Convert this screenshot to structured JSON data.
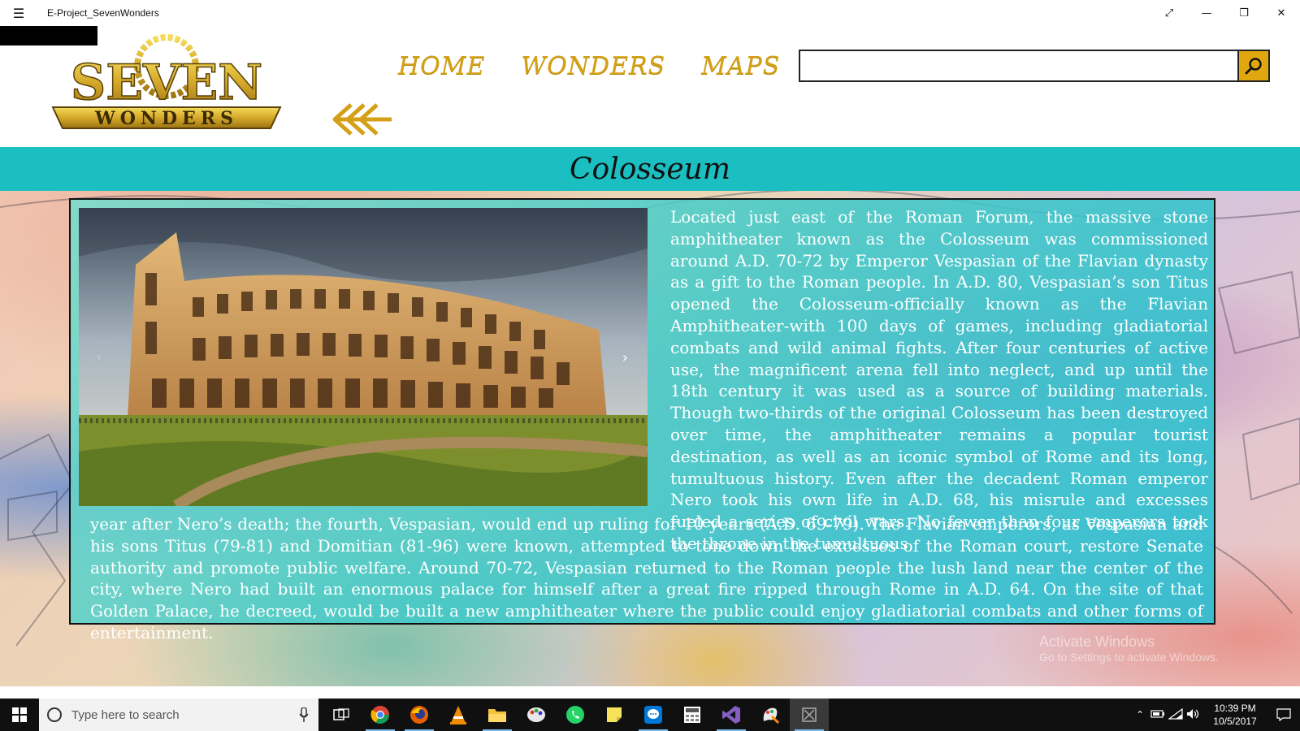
{
  "window": {
    "title": "E-Project_SevenWonders",
    "menu_icon": "hamburger-icon",
    "controls": [
      "fullscreen-icon",
      "minimize-icon",
      "restore-icon",
      "close-icon"
    ]
  },
  "header": {
    "logo_line1": "SEVEN",
    "logo_line2": "WONDERS",
    "nav": [
      "HOME",
      "WONDERS",
      "MAPS"
    ],
    "search": {
      "value": "",
      "placeholder": "",
      "icon": "search-icon"
    },
    "back_icon": "double-arrow-back-icon"
  },
  "banner": {
    "title": "Colosseum"
  },
  "content": {
    "paragraph_right": "Located just east of the Roman Forum, the massive stone amphitheater known as the Colosseum was commissioned around A.D. 70-72 by Emperor Vespasian of the Flavian dynasty as a gift to the Roman people. In A.D. 80, Vespasian’s son Titus opened the Colosseum-officially known as the Flavian Amphitheater-with 100 days of games, including gladiatorial combats and wild animal fights. After four centuries of active use, the magnificent arena fell into neglect, and up until the 18th century it was used as a source of building materials. Though two-thirds of the original Colosseum has been destroyed over time, the amphitheater remains a popular tourist destination, as well as an iconic symbol of Rome and its long, tumultuous history. Even after the decadent Roman emperor Nero took his own life in A.D. 68, his misrule and excesses fueled a series of civil wars. No fewer than four emperors took the throne in the tumultuous",
    "paragraph_bottom": "year after Nero’s death; the fourth, Vespasian, would end up ruling for 10 years (A.D. 69-79). The Flavian emperors, as Vespasian and his sons Titus (79-81) and Domitian (81-96) were known, attempted to tone down the excesses of the Roman court, restore Senate authority and promote public welfare. Around 70-72, Vespasian returned to the Roman people the lush land near the center of the city, where Nero had built an enormous palace for himself after a great fire ripped through Rome in A.D. 64. On the site of that Golden Palace, he decreed, would be built a new amphitheater where the public could enjoy gladiatorial combats and other forms of entertainment.",
    "image_alt": "Colosseum photo",
    "next_symbol": "›",
    "prev_symbol": "‹"
  },
  "watermark": {
    "line1": "Activate Windows",
    "line2": "Go to Settings to activate Windows."
  },
  "taskbar": {
    "search_placeholder": "Type here to search",
    "apps": [
      "task-view-icon",
      "chrome-icon",
      "firefox-icon",
      "vlc-icon",
      "file-explorer-icon",
      "paint-icon",
      "whatsapp-icon",
      "sticky-notes-icon",
      "messaging-icon",
      "calculator-icon",
      "visual-studio-icon",
      "paint3d-icon",
      "app-icon"
    ],
    "time": "10:39 PM",
    "date": "10/5/2017",
    "colors": {
      "accent": "#76b9ed",
      "taskbar_bg": "#101010"
    }
  },
  "colors": {
    "nav_gold": "#d4a017",
    "banner_teal": "#1bbfc1",
    "search_button": "#e0a70e"
  }
}
